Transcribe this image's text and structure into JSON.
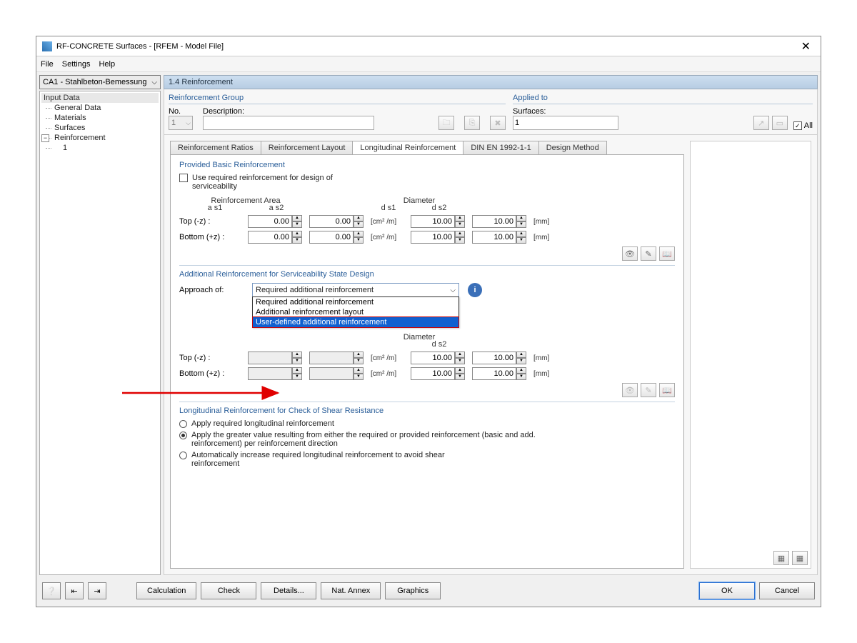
{
  "window": {
    "title": "RF-CONCRETE Surfaces - [RFEM - Model File]"
  },
  "menu": {
    "file": "File",
    "settings": "Settings",
    "help": "Help"
  },
  "sidebar": {
    "combo": "CA1 - Stahlbeton-Bemessung",
    "header": "Input Data",
    "items": [
      "General Data",
      "Materials",
      "Surfaces"
    ],
    "reinforcement": "Reinforcement",
    "reinforcement_child": "1"
  },
  "section_title": "1.4 Reinforcement",
  "rg": {
    "title": "Reinforcement Group",
    "no_label": "No.",
    "no_value": "1",
    "desc_label": "Description:"
  },
  "applied": {
    "title": "Applied to",
    "surfaces_label": "Surfaces:",
    "surfaces_value": "1",
    "all": "All"
  },
  "tabs": [
    "Reinforcement Ratios",
    "Reinforcement Layout",
    "Longitudinal Reinforcement",
    "DIN EN 1992-1-1",
    "Design Method"
  ],
  "pbr": {
    "title": "Provided Basic Reinforcement",
    "checkbox": "Use required reinforcement for design of serviceability",
    "area_label": "Reinforcement Area",
    "dia_label": "Diameter",
    "as1": "a s1",
    "as2": "a s2",
    "ds1": "d s1",
    "ds2": "d s2",
    "top": "Top (-z) :",
    "bottom": "Bottom (+z) :",
    "unit_area": "[cm² /m]",
    "unit_dia": "[mm]",
    "v00": "0.00",
    "v10": "10.00"
  },
  "addr": {
    "title": "Additional Reinforcement for Serviceability State Design",
    "approach": "Approach of:",
    "selected": "Required additional reinforcement",
    "opts": [
      "Required additional reinforcement",
      "Additional reinforcement layout",
      "User-defined additional reinforcement"
    ],
    "dia_label": "Diameter",
    "ds2": "d s2"
  },
  "shear": {
    "title": "Longitudinal Reinforcement for Check of Shear Resistance",
    "o1": "Apply required longitudinal reinforcement",
    "o2": "Apply the greater value resulting from either the required or provided reinforcement (basic and add. reinforcement) per reinforcement direction",
    "o3": "Automatically increase required longitudinal reinforcement to avoid shear reinforcement"
  },
  "buttons": {
    "calculation": "Calculation",
    "check": "Check",
    "details": "Details...",
    "natannex": "Nat. Annex",
    "graphics": "Graphics",
    "ok": "OK",
    "cancel": "Cancel"
  }
}
